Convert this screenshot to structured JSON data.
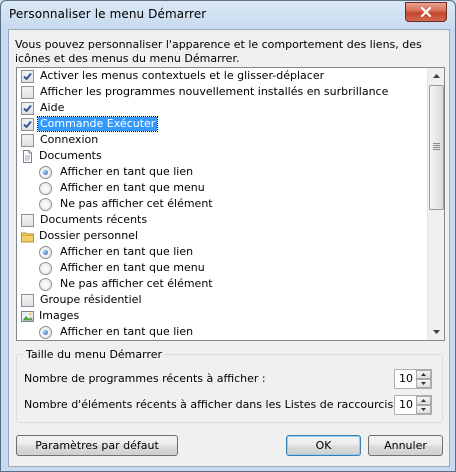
{
  "window": {
    "title": "Personnaliser le menu Démarrer",
    "close_icon": "close-icon"
  },
  "description": "Vous pouvez personnaliser l'apparence et le comportement des liens, des icônes et des menus du menu Démarrer.",
  "options": [
    {
      "type": "checkbox",
      "label": "Activer les menus contextuels et le glisser-déplacer",
      "checked": true,
      "selected": false
    },
    {
      "type": "checkbox",
      "label": "Afficher les programmes nouvellement installés en surbrillance",
      "checked": false,
      "selected": false
    },
    {
      "type": "checkbox",
      "label": "Aide",
      "checked": true,
      "selected": false
    },
    {
      "type": "checkbox",
      "label": "Commande Exécuter",
      "checked": true,
      "selected": true
    },
    {
      "type": "checkbox",
      "label": "Connexion",
      "checked": false,
      "selected": false
    },
    {
      "type": "group",
      "label": "Documents",
      "icon": "document-icon"
    },
    {
      "type": "radio",
      "label": "Afficher en tant que lien",
      "checked": true
    },
    {
      "type": "radio",
      "label": "Afficher en tant que menu",
      "checked": false
    },
    {
      "type": "radio",
      "label": "Ne pas afficher cet élément",
      "checked": false
    },
    {
      "type": "checkbox",
      "label": "Documents récents",
      "checked": false,
      "selected": false
    },
    {
      "type": "group",
      "label": "Dossier personnel",
      "icon": "folder-icon"
    },
    {
      "type": "radio",
      "label": "Afficher en tant que lien",
      "checked": true
    },
    {
      "type": "radio",
      "label": "Afficher en tant que menu",
      "checked": false
    },
    {
      "type": "radio",
      "label": "Ne pas afficher cet élément",
      "checked": false
    },
    {
      "type": "checkbox",
      "label": "Groupe résidentiel",
      "checked": false,
      "selected": false
    },
    {
      "type": "group",
      "label": "Images",
      "icon": "images-icon"
    },
    {
      "type": "radio",
      "label": "Afficher en tant que lien",
      "checked": true
    }
  ],
  "size_group": {
    "title": "Taille du menu Démarrer",
    "recent_programs_label": "Nombre de programmes récents à afficher :",
    "recent_programs_value": "10",
    "recent_items_label": "Nombre d'éléments récents à afficher dans les Listes de raccourcis :",
    "recent_items_value": "10"
  },
  "buttons": {
    "defaults": "Paramètres par défaut",
    "ok": "OK",
    "cancel": "Annuler"
  },
  "colors": {
    "selection": "#3399ff",
    "close_button": "#c4452c"
  }
}
